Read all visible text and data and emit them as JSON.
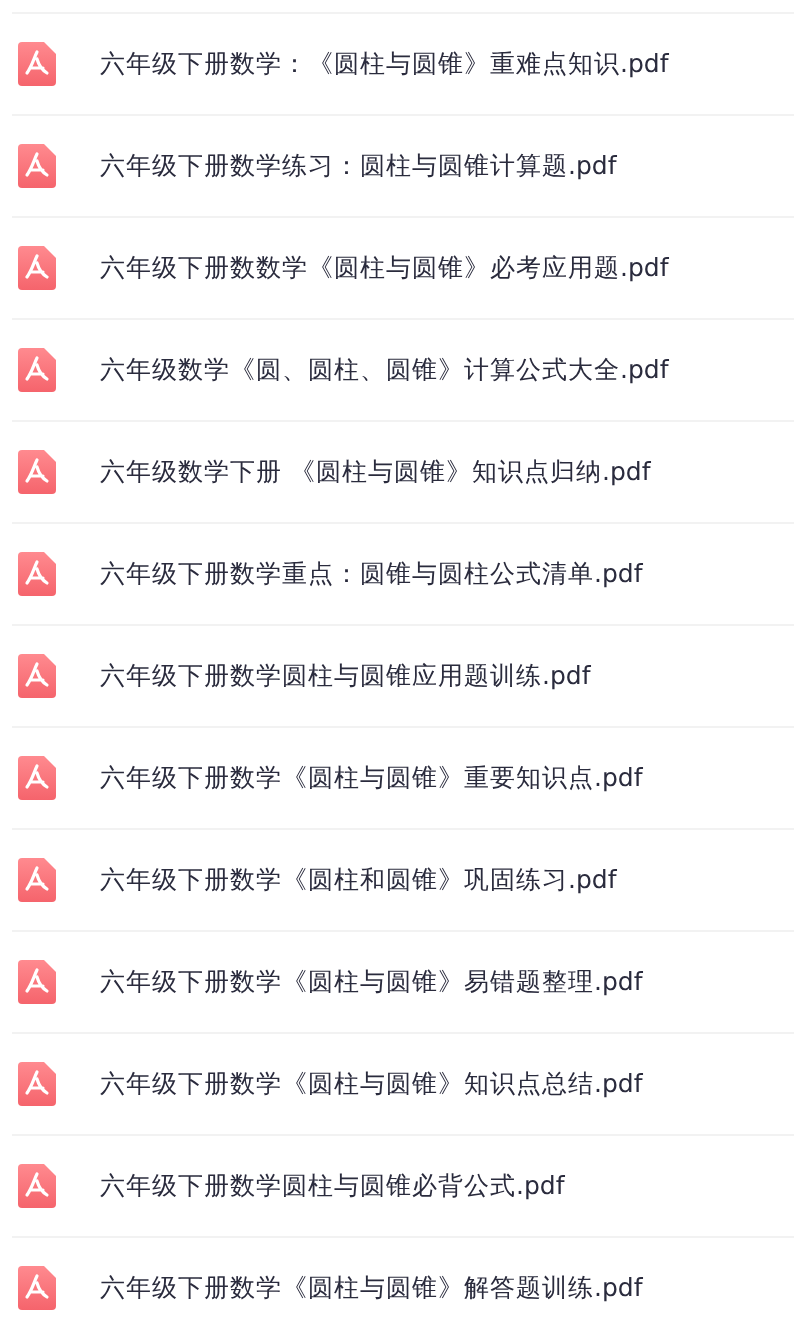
{
  "files": [
    {
      "name": "六年级下册数学：《圆柱与圆锥》重难点知识.pdf"
    },
    {
      "name": "六年级下册数学练习：圆柱与圆锥计算题.pdf"
    },
    {
      "name": "六年级下册数数学《圆柱与圆锥》必考应用题.pdf"
    },
    {
      "name": "六年级数学《圆、圆柱、圆锥》计算公式大全.pdf"
    },
    {
      "name": "六年级数学下册 《圆柱与圆锥》知识点归纳.pdf"
    },
    {
      "name": "六年级下册数学重点：圆锥与圆柱公式清单.pdf"
    },
    {
      "name": "六年级下册数学圆柱与圆锥应用题训练.pdf"
    },
    {
      "name": "六年级下册数学《圆柱与圆锥》重要知识点.pdf"
    },
    {
      "name": "六年级下册数学《圆柱和圆锥》巩固练习.pdf"
    },
    {
      "name": "六年级下册数学《圆柱与圆锥》易错题整理.pdf"
    },
    {
      "name": "六年级下册数学《圆柱与圆锥》知识点总结.pdf"
    },
    {
      "name": "六年级下册数学圆柱与圆锥必背公式.pdf"
    },
    {
      "name": "六年级下册数学《圆柱与圆锥》解答题训练.pdf"
    }
  ]
}
